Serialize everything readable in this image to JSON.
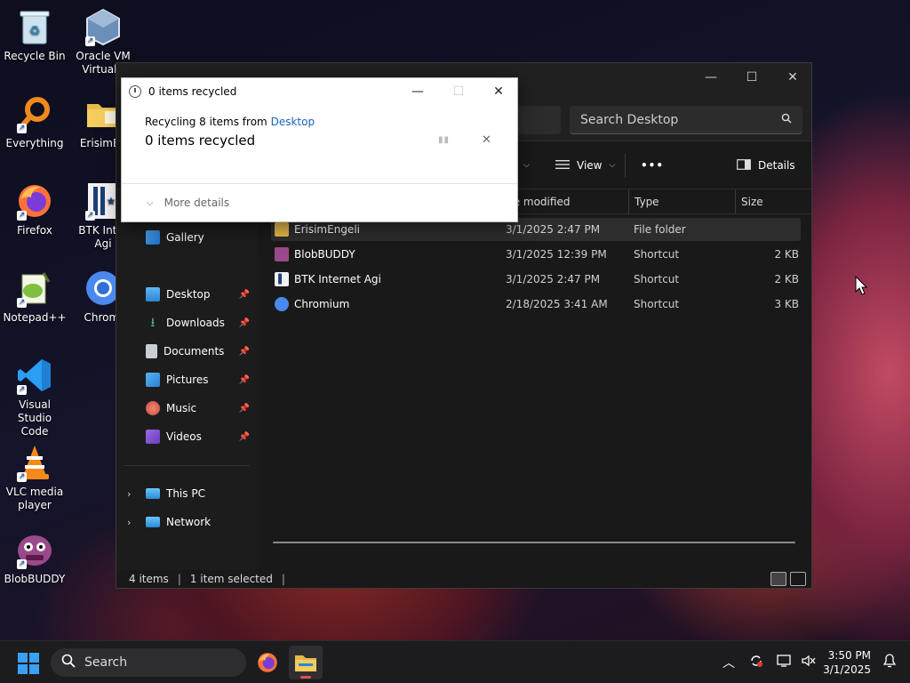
{
  "desktop": {
    "icons": [
      {
        "label": "Recycle Bin",
        "icon": "recycle-bin-icon"
      },
      {
        "label": "Oracle VM\nVirtualB",
        "icon": "virtualbox-icon"
      },
      {
        "label": "Everything",
        "icon": "everything-search-icon"
      },
      {
        "label": "ErisimEn",
        "icon": "folder-icon"
      },
      {
        "label": "Firefox",
        "icon": "firefox-icon"
      },
      {
        "label": "BTK Inter\nAgi",
        "icon": "btk-icon"
      },
      {
        "label": "Notepad++",
        "icon": "notepadpp-icon"
      },
      {
        "label": "Chromi",
        "icon": "chromium-icon"
      },
      {
        "label": "Visual Studio\nCode",
        "icon": "vscode-icon"
      },
      {
        "label": "VLC media\nplayer",
        "icon": "vlc-icon"
      },
      {
        "label": "BlobBUDDY",
        "icon": "blobbuddy-icon"
      }
    ]
  },
  "explorer": {
    "search_placeholder": "Search Desktop",
    "toolbar": {
      "view_label": "View",
      "more_label": "•••",
      "details_label": "Details"
    },
    "columns": {
      "modified": "te modified",
      "type": "Type",
      "size": "Size"
    },
    "nav": {
      "gallery": "Gallery",
      "desktop": "Desktop",
      "downloads": "Downloads",
      "documents": "Documents",
      "pictures": "Pictures",
      "music": "Music",
      "videos": "Videos",
      "this_pc": "This PC",
      "network": "Network"
    },
    "files": [
      {
        "name": "ErisimEngeli",
        "modified": "3/1/2025 2:47 PM",
        "type": "File folder",
        "size": ""
      },
      {
        "name": "BlobBUDDY",
        "modified": "3/1/2025 12:39 PM",
        "type": "Shortcut",
        "size": "2 KB"
      },
      {
        "name": "BTK Internet Agi",
        "modified": "3/1/2025 2:47 PM",
        "type": "Shortcut",
        "size": "2 KB"
      },
      {
        "name": "Chromium",
        "modified": "2/18/2025 3:41 AM",
        "type": "Shortcut",
        "size": "3 KB"
      }
    ],
    "status": {
      "count": "4 items",
      "selected": "1 item selected"
    }
  },
  "dialog": {
    "title": "0 items recycled",
    "sub_prefix": "Recycling 8 items from",
    "sub_link": "Desktop",
    "main": "0 items recycled",
    "more_details": "More details"
  },
  "taskbar": {
    "search_label": "Search",
    "time": "3:50 PM",
    "date": "3/1/2025"
  },
  "colors": {
    "accent": "#3aa0f3",
    "link": "#1a63b8",
    "explorer_bg": "#191919"
  }
}
